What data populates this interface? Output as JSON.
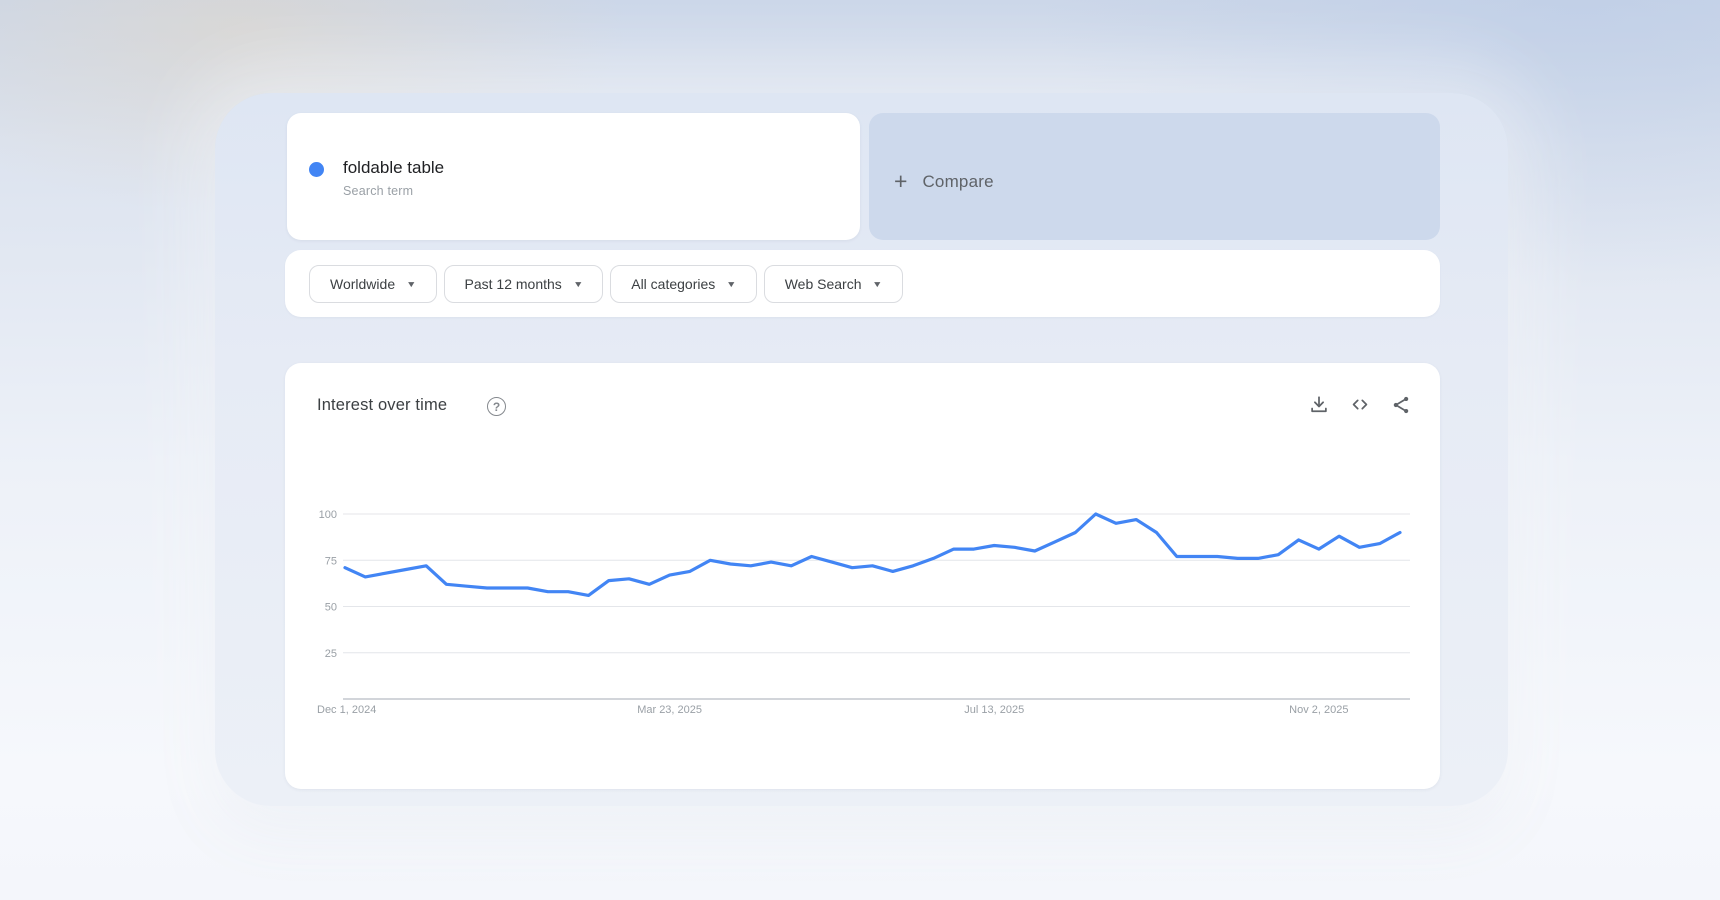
{
  "search_card": {
    "term": "foldable table",
    "subtitle": "Search term",
    "dot_color": "#4285f4"
  },
  "compare_card": {
    "plus_glyph": "+",
    "label": "Compare"
  },
  "filter_bar": {
    "caret_glyph": "▼",
    "filters": [
      {
        "name": "geo",
        "label": "Worldwide"
      },
      {
        "name": "time-range",
        "label": "Past 12 months"
      },
      {
        "name": "category",
        "label": "All categories"
      },
      {
        "name": "search-type",
        "label": "Web Search"
      }
    ]
  },
  "chart_section": {
    "title": "Interest over time",
    "help_glyph": "?"
  },
  "chart_data": {
    "type": "line",
    "title": "Interest over time",
    "x_unit": "week",
    "x_tick_labels": [
      "Dec 1, 2024",
      "Mar 23, 2025",
      "Jul 13, 2025",
      "Nov 2, 2025"
    ],
    "x_tick_indices": [
      0,
      16,
      32,
      48
    ],
    "y_ticks": [
      25,
      50,
      75,
      100
    ],
    "ylim": [
      0,
      100
    ],
    "grid": true,
    "legend_visible": false,
    "line_width": 3.2,
    "series": [
      {
        "name": "foldable table",
        "color": "#4285f4",
        "values": [
          71,
          66,
          68,
          70,
          72,
          62,
          61,
          60,
          60,
          60,
          58,
          58,
          56,
          64,
          65,
          62,
          67,
          69,
          75,
          73,
          72,
          74,
          72,
          77,
          74,
          71,
          72,
          69,
          72,
          76,
          81,
          81,
          83,
          82,
          80,
          85,
          90,
          100,
          95,
          97,
          90,
          77,
          77,
          77,
          76,
          76,
          78,
          86,
          81,
          88,
          82,
          84,
          90
        ]
      }
    ]
  }
}
